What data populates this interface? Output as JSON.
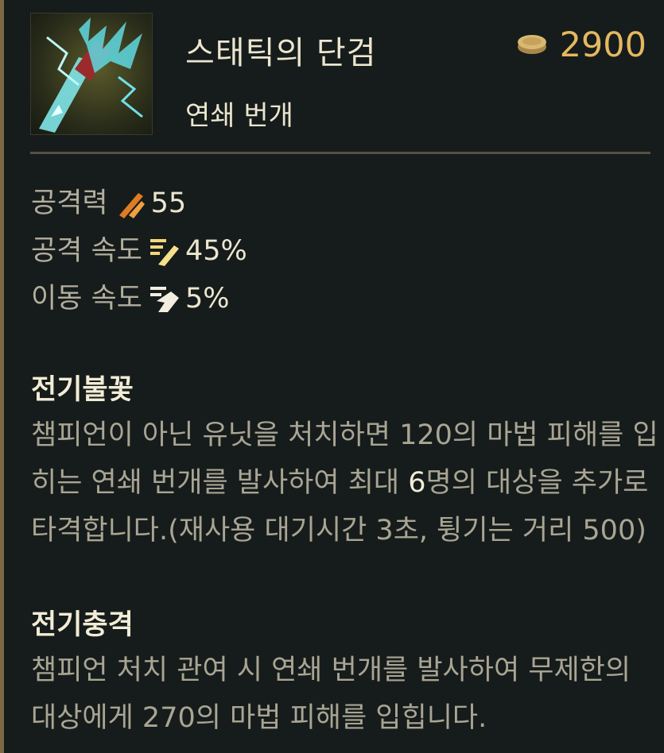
{
  "item": {
    "name": "스태틱의 단검",
    "subtitle": "연쇄 번개",
    "price": "2900",
    "icon": "lightning-dagger-icon"
  },
  "stats": [
    {
      "label": "공격력",
      "value": "55",
      "icon": "attack-damage-icon"
    },
    {
      "label": "공격 속도",
      "value": "45%",
      "icon": "attack-speed-icon"
    },
    {
      "label": "이동 속도",
      "value": "5%",
      "icon": "move-speed-icon"
    }
  ],
  "passives": [
    {
      "title": "전기불꽃",
      "desc_a": "챔피언이 아닌 유닛을 처치하면 120의 마법 피해를 입히는 연쇄 번개를 발사하여 최대 ",
      "desc_highlight": "6",
      "desc_b": "명의 대상을 추가로 타격합니다.(재사용 대기시간 3초, 튕기는 거리 500)"
    },
    {
      "title": "전기충격",
      "desc": "챔피언 처치 관여 시 연쇄 번개를 발사하여 무제한의 대상에게 270의 마법 피해를 입힙니다."
    }
  ],
  "colors": {
    "background": "#171d1c",
    "gold": "#e5b85f",
    "text_bright": "#ece6cf",
    "text_dim": "#a9a594",
    "border": "#7a6a43"
  }
}
